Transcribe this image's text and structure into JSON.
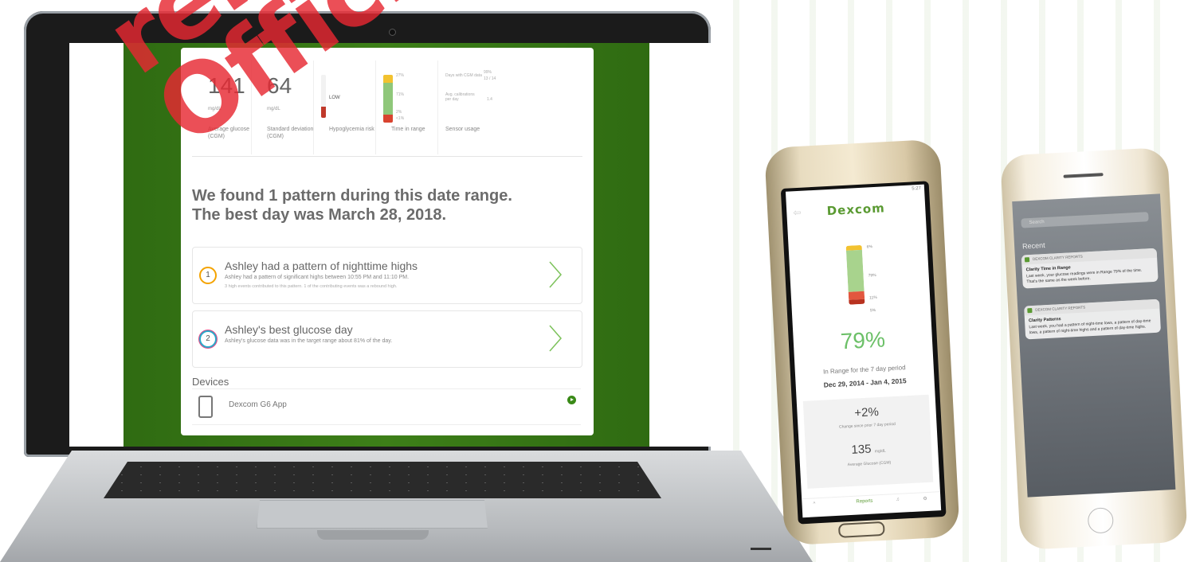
{
  "watermark": [
    "rele",
    "Official"
  ],
  "laptop": {
    "stats": [
      {
        "value": "141",
        "unit": "mg/dL",
        "label": "Average glucose (CGM)"
      },
      {
        "value": "64",
        "unit": "mg/dL",
        "label": "Standard deviation (CGM)"
      },
      {
        "label": "Hypoglycemia risk",
        "risk": "LOW"
      },
      {
        "label": "Time in range",
        "ticks": [
          "27%",
          "71%",
          "2%",
          "<1%"
        ]
      },
      {
        "label": "Sensor usage",
        "rows": [
          {
            "k": "Days with CGM data",
            "v": "13 / 14"
          },
          {
            "k": "Avg. calibrations per day",
            "v": "1.4"
          }
        ],
        "top_value": "99%"
      }
    ],
    "headline_line1": "We found 1 pattern during this date range.",
    "headline_line2": "The best day was March 28, 2018.",
    "patterns": [
      {
        "num": "1",
        "title": "Ashley had a pattern of nighttime highs",
        "sub": "Ashley had a pattern of significant highs between 10:55 PM and 11:10 PM.",
        "sub2": "3 high events contributed to this pattern. 1 of the contributing events was a rebound high.",
        "ring_color": "#f4a300"
      },
      {
        "num": "2",
        "title": "Ashley's best glucose day",
        "sub": "Ashley's glucose data was in the target range about 81% of the day.",
        "sub2": "",
        "ring_color": "#2aa9c9"
      }
    ],
    "devices_title": "Devices",
    "device_name": "Dexcom G6 App"
  },
  "android": {
    "status": "5:27",
    "logo": "Dexcom",
    "ticks": [
      "6%",
      "79%",
      "11%",
      "5%"
    ],
    "percent": "79%",
    "subtitle": "In Range for the 7 day period",
    "dates": "Dec 29, 2014 - Jan 4, 2015",
    "change": "+2%",
    "change_label": "Change since prior 7 day period",
    "avg_value": "135",
    "avg_unit": "mg/dL",
    "avg_label": "Average Glucose (CGM)",
    "nav": [
      "^",
      "Reports",
      "♫",
      "⚙"
    ]
  },
  "iphone": {
    "search": "Search",
    "recent": "Recent",
    "notifications": [
      {
        "app": "DEXCOM CLARITY REPORTS",
        "title": "Clarity Time in Range",
        "body": "Last week, your glucose readings were in Range 79% of the time. That's the same as the week before."
      },
      {
        "app": "DEXCOM CLARITY REPORTS",
        "title": "Clarity Patterns",
        "body": "Last week, you had a pattern of night-time lows, a pattern of day-time lows, a pattern of night-time highs and a pattern of day-time highs."
      }
    ]
  },
  "colors": {
    "brand_green": "#3d7f18",
    "in_range": "#6cc068",
    "high": "#f2c230",
    "low": "#d9432f"
  }
}
